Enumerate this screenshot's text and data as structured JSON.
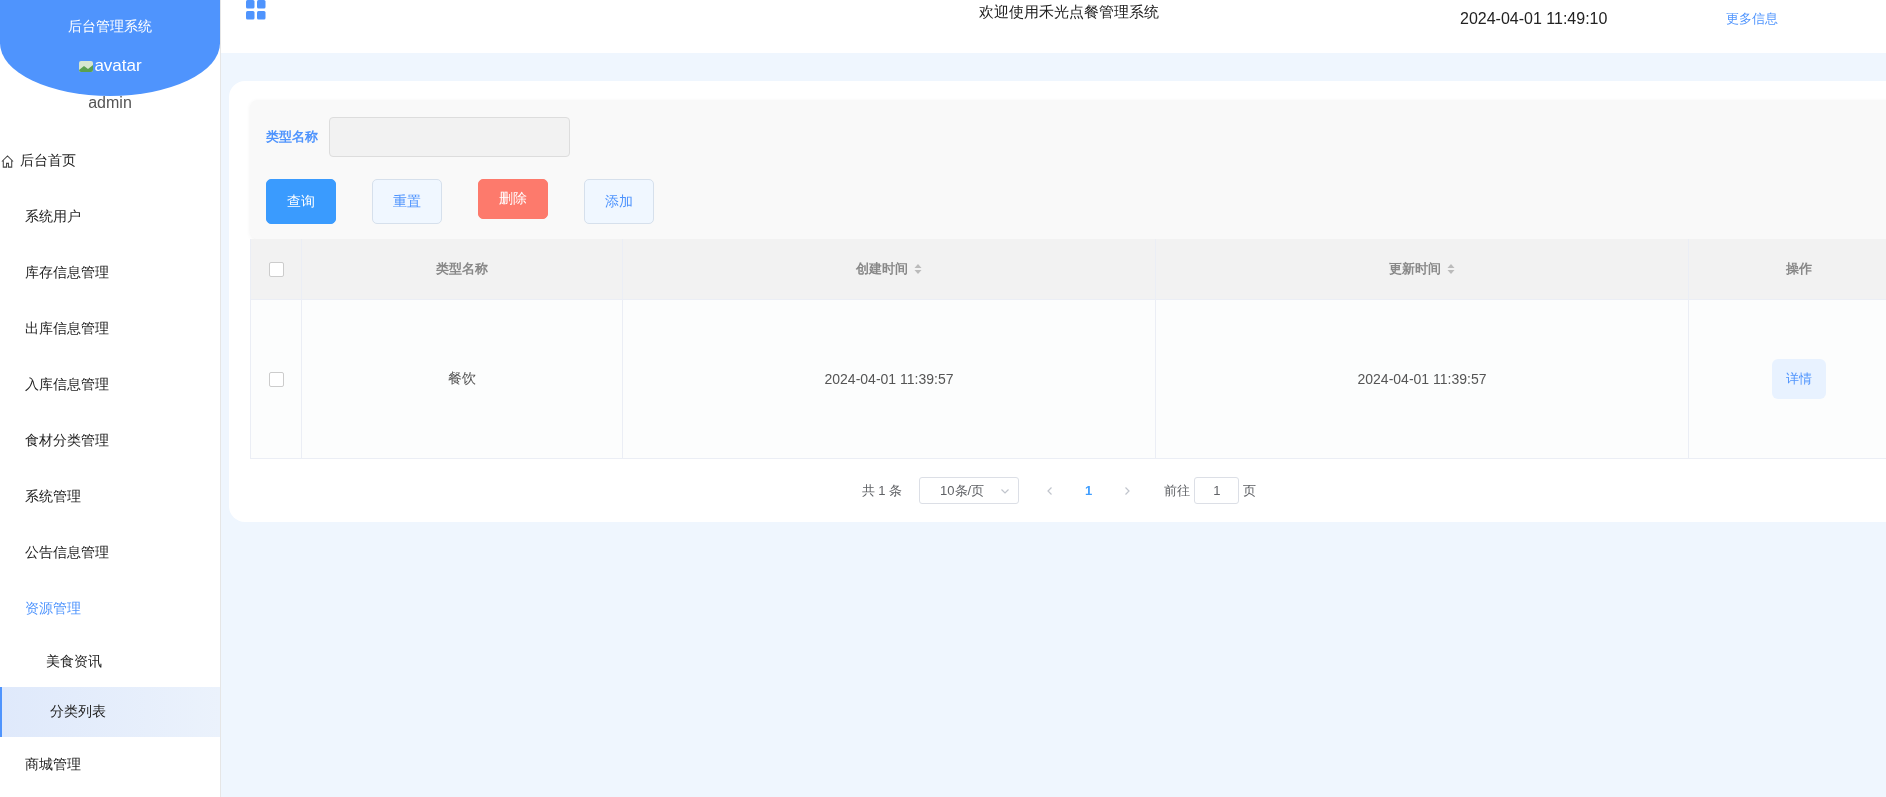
{
  "sidebar": {
    "brand": "后台管理系统",
    "avatar_alt": "avatar",
    "username": "admin",
    "items": [
      {
        "label": "后台首页",
        "kind": "home",
        "selected": false
      },
      {
        "label": "系统用户",
        "kind": "link",
        "selected": false
      },
      {
        "label": "库存信息管理",
        "kind": "link",
        "selected": false
      },
      {
        "label": "出库信息管理",
        "kind": "link",
        "selected": false
      },
      {
        "label": "入库信息管理",
        "kind": "link",
        "selected": false
      },
      {
        "label": "食材分类管理",
        "kind": "link",
        "selected": false
      },
      {
        "label": "系统管理",
        "kind": "link",
        "selected": false
      },
      {
        "label": "公告信息管理",
        "kind": "link",
        "selected": false
      },
      {
        "label": "资源管理",
        "kind": "group",
        "expanded": true,
        "children": [
          {
            "label": "美食资讯",
            "selected": false
          },
          {
            "label": "分类列表",
            "selected": true
          }
        ]
      },
      {
        "label": "商城管理",
        "kind": "link",
        "selected": false
      }
    ]
  },
  "header": {
    "title": "欢迎使用禾光点餐管理系统",
    "datetime": "2024-04-01 11:49:10",
    "more_link": "更多信息"
  },
  "search": {
    "label": "类型名称",
    "buttons": [
      {
        "label": "查询",
        "kind": "primary"
      },
      {
        "label": "重置",
        "kind": "plain"
      },
      {
        "label": "删除",
        "kind": "danger"
      },
      {
        "label": "添加",
        "kind": "plain"
      }
    ]
  },
  "table": {
    "select_all_checked": false,
    "columns": [
      {
        "label": "类型名称",
        "sortable": false
      },
      {
        "label": "创建时间",
        "sortable": true
      },
      {
        "label": "更新时间",
        "sortable": true
      },
      {
        "label": "操作",
        "sortable": false
      }
    ],
    "rows": [
      {
        "checked": false,
        "cells": [
          "餐饮",
          "2024-04-01 11:39:57",
          "2024-04-01 11:39:57"
        ],
        "action": "详情"
      }
    ]
  },
  "pagination": {
    "total": "共 1 条",
    "page_size": "10条/页",
    "pages": [
      {
        "label": "1",
        "selected": true
      }
    ],
    "goto_label": "前往",
    "goto_value": "1",
    "goto_suffix": "页"
  }
}
